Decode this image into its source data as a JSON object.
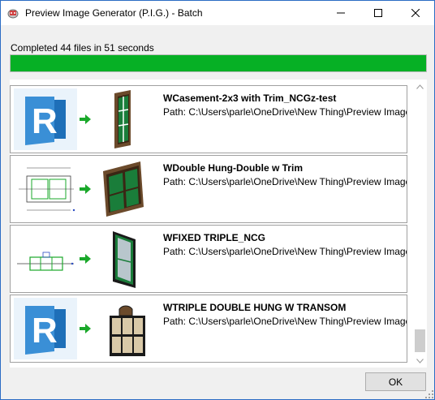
{
  "window": {
    "title": "Preview Image Generator (P.I.G.) - Batch",
    "controls": {
      "minimize": "minimize-icon",
      "maximize": "maximize-icon",
      "close": "close-icon"
    }
  },
  "status": {
    "text": "Completed 44 files in 51 seconds",
    "progress_fraction": 1.0,
    "progress_color": "#06b025"
  },
  "items": [
    {
      "name": "WCasement-2x3 with Trim_NCGz-test",
      "path": "Path: C:\\Users\\parle\\OneDrive\\New Thing\\Preview Image",
      "source_icon": "revit-logo-icon",
      "output_icon": "casement-window-icon"
    },
    {
      "name": "WDouble Hung-Double w Trim",
      "path": "Path: C:\\Users\\parle\\OneDrive\\New Thing\\Preview Image",
      "source_icon": "drawing-preview-icon",
      "output_icon": "double-hung-window-icon"
    },
    {
      "name": "WFIXED TRIPLE_NCG",
      "path": "Path: C:\\Users\\parle\\OneDrive\\New Thing\\Preview Image",
      "source_icon": "drawing-preview-icon",
      "output_icon": "fixed-window-icon"
    },
    {
      "name": "WTRIPLE DOUBLE HUNG W TRANSOM",
      "path": "Path: C:\\Users\\parle\\OneDrive\\New Thing\\Preview Image",
      "source_icon": "revit-logo-icon",
      "output_icon": "transom-window-icon"
    }
  ],
  "footer": {
    "ok_label": "OK"
  },
  "colors": {
    "accent_arrow": "#1aa82a",
    "revit_blue": "#1e6fb8",
    "window_border": "#2b6cc4"
  }
}
